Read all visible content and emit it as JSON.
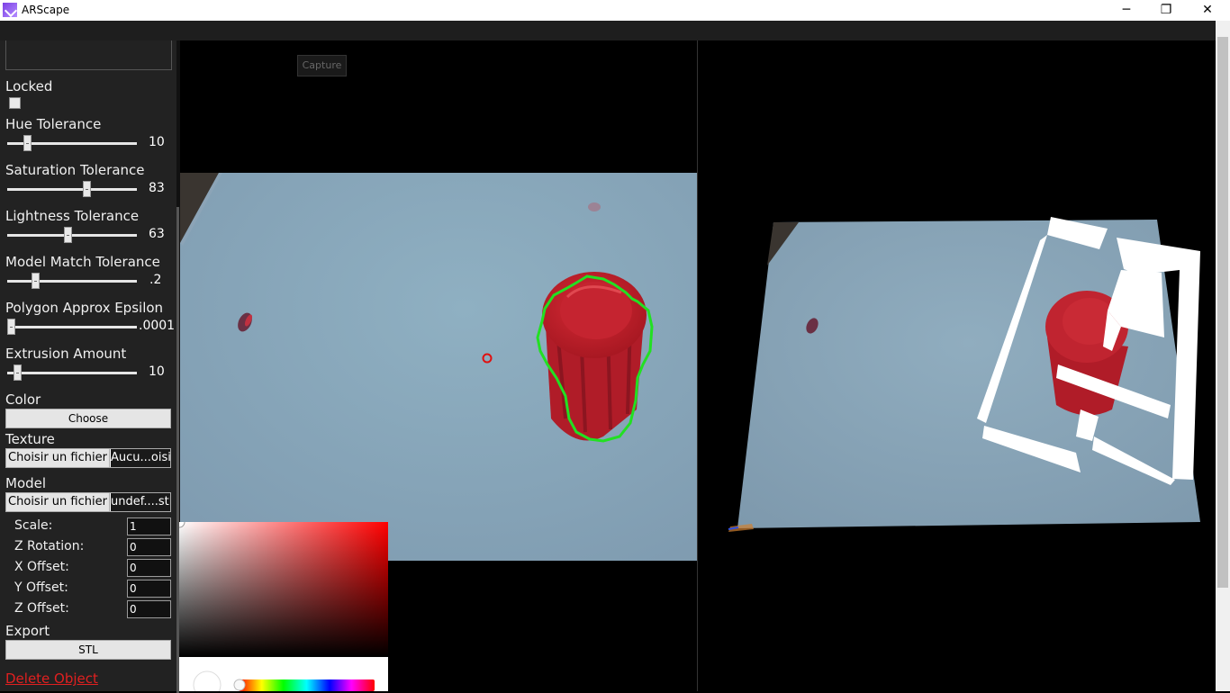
{
  "window": {
    "title": "ARScape",
    "minimize": "─",
    "restore": "❐",
    "close": "✕"
  },
  "sidebar": {
    "locked_label": "Locked",
    "sliders": [
      {
        "label": "Hue Tolerance",
        "value": "10",
        "fraction": 0.13
      },
      {
        "label": "Saturation Tolerance",
        "value": "83",
        "fraction": 0.62
      },
      {
        "label": "Lightness Tolerance",
        "value": "63",
        "fraction": 0.47
      },
      {
        "label": "Model Match Tolerance",
        "value": ".2",
        "fraction": 0.2
      },
      {
        "label": "Polygon Approx Epsilon",
        "value": ".0001",
        "fraction": 0.0
      },
      {
        "label": "Extrusion Amount",
        "value": "10",
        "fraction": 0.05
      }
    ],
    "color_label": "Color",
    "choose_button": "Choose",
    "texture_label": "Texture",
    "texture_file_button": "Choisir un fichier",
    "texture_file_name": "Aucu...oisi",
    "model_label": "Model",
    "model_file_button": "Choisir un fichier",
    "model_file_name": "undef....stl",
    "fields": [
      {
        "label": "Scale:",
        "value": "1"
      },
      {
        "label": "Z Rotation:",
        "value": "0"
      },
      {
        "label": "X Offset:",
        "value": "0"
      },
      {
        "label": "Y Offset:",
        "value": "0"
      },
      {
        "label": "Z Offset:",
        "value": "0"
      }
    ],
    "export_label": "Export",
    "stl_button": "STL",
    "delete_link": "Delete Object"
  },
  "capture_button": "Capture",
  "colors": {
    "contour": "#22e022",
    "marker": "#e01010",
    "table": "#8fa8b8",
    "object_red": "#c8202a"
  }
}
